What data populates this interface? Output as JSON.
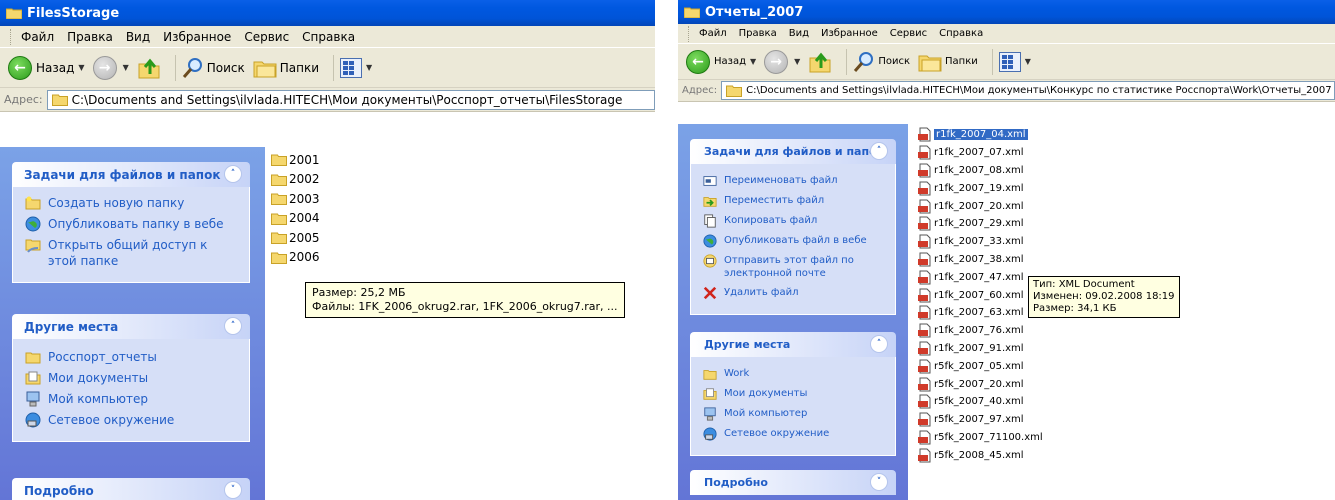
{
  "left": {
    "title": "FilesStorage",
    "menu": [
      "Файл",
      "Правка",
      "Вид",
      "Избранное",
      "Сервис",
      "Справка"
    ],
    "toolbar": {
      "back": "Назад",
      "search": "Поиск",
      "folders": "Папки"
    },
    "address": {
      "label": "Адрес:",
      "path": "C:\\Documents and Settings\\ilvlada.HITECH\\Мои документы\\Росспорт_отчеты\\FilesStorage"
    },
    "tasks_panel": {
      "title": "Задачи для файлов и папок",
      "items": [
        "Создать новую папку",
        "Опубликовать папку в вебе",
        "Открыть общий доступ к этой папке"
      ]
    },
    "places_panel": {
      "title": "Другие места",
      "items": [
        "Росспорт_отчеты",
        "Мои документы",
        "Мой компьютер",
        "Сетевое окружение"
      ]
    },
    "details_panel": {
      "title": "Подробно"
    },
    "folders": [
      "2001",
      "2002",
      "2003",
      "2004",
      "2005",
      "2006"
    ],
    "tooltip": {
      "size": "Размер: 25,2 МБ",
      "files": "Файлы: 1FK_2006_okrug2.rar, 1FK_2006_okrug7.rar, ..."
    }
  },
  "right": {
    "title": "Отчеты_2007",
    "menu": [
      "Файл",
      "Правка",
      "Вид",
      "Избранное",
      "Сервис",
      "Справка"
    ],
    "toolbar": {
      "back": "Назад",
      "search": "Поиск",
      "folders": "Папки"
    },
    "address": {
      "label": "Адрес:",
      "path": "C:\\Documents and Settings\\ilvlada.HITECH\\Мои документы\\Конкурс по статистике Росспорта\\Work\\Отчеты_2007"
    },
    "tasks_panel": {
      "title": "Задачи для файлов и папок",
      "items": [
        "Переименовать файл",
        "Переместить файл",
        "Копировать файл",
        "Опубликовать файл в вебе",
        "Отправить этот файл по электронной почте",
        "Удалить файл"
      ]
    },
    "places_panel": {
      "title": "Другие места",
      "items": [
        "Work",
        "Мои документы",
        "Мой компьютер",
        "Сетевое окружение"
      ]
    },
    "details_panel": {
      "title": "Подробно"
    },
    "files": [
      "r1fk_2007_04.xml",
      "r1fk_2007_07.xml",
      "r1fk_2007_08.xml",
      "r1fk_2007_19.xml",
      "r1fk_2007_20.xml",
      "r1fk_2007_29.xml",
      "r1fk_2007_33.xml",
      "r1fk_2007_38.xml",
      "r1fk_2007_47.xml",
      "r1fk_2007_60.xml",
      "r1fk_2007_63.xml",
      "r1fk_2007_76.xml",
      "r1fk_2007_91.xml",
      "r5fk_2007_05.xml",
      "r5fk_2007_20.xml",
      "r5fk_2007_40.xml",
      "r5fk_2007_97.xml",
      "r5fk_2007_71100.xml",
      "r5fk_2008_45.xml"
    ],
    "selected_file": "r1fk_2007_04.xml",
    "tooltip": {
      "type": "Тип: XML Document",
      "modified": "Изменен: 09.02.2008 18:19",
      "size": "Размер: 34,1 КБ"
    }
  }
}
